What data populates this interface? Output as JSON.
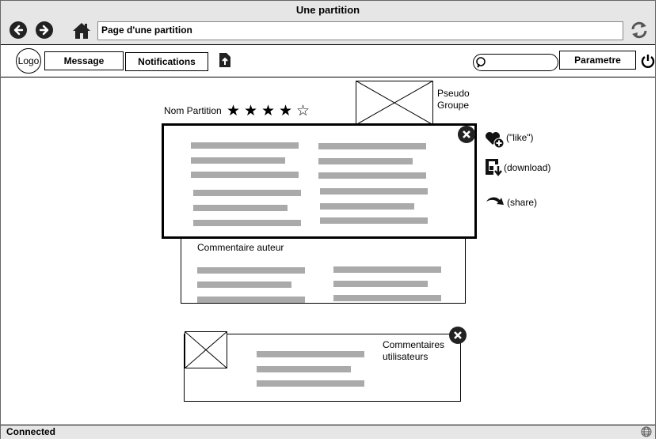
{
  "window": {
    "title": "Une partition"
  },
  "browser": {
    "address": "Page d'une partition"
  },
  "toolbar": {
    "logo": "Logo",
    "message": "Message",
    "notifications": "Notifications",
    "parametre": "Parametre"
  },
  "partition": {
    "name_label": "Nom Partition",
    "rating": {
      "value": 4,
      "max": 5
    },
    "pseudo": "Pseudo",
    "groupe": "Groupe"
  },
  "actions": {
    "like": "(\"like\")",
    "download": "(download)",
    "share": "(share)"
  },
  "author": {
    "label": "Commentaire auteur"
  },
  "users": {
    "line1": "Commentaires",
    "line2": "utilisateurs"
  },
  "status": {
    "text": "Connected"
  }
}
